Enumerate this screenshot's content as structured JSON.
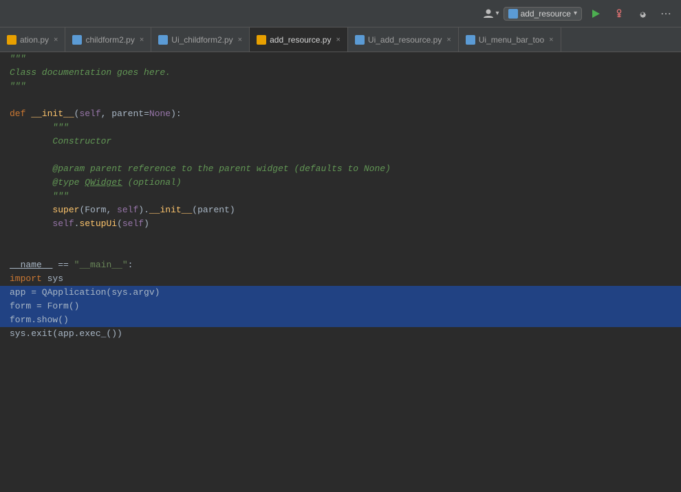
{
  "toolbar": {
    "run_config_label": "add_resource",
    "run_button_title": "Run",
    "debug_button_title": "Debug",
    "settings_title": "Settings"
  },
  "tabs": [
    {
      "id": "tab1",
      "label": "ation.py",
      "icon": "orange",
      "active": false,
      "closeable": true
    },
    {
      "id": "tab2",
      "label": "childform2.py",
      "icon": "blue",
      "active": false,
      "closeable": true
    },
    {
      "id": "tab3",
      "label": "Ui_childform2.py",
      "icon": "blue",
      "active": false,
      "closeable": true
    },
    {
      "id": "tab4",
      "label": "add_resource.py",
      "icon": "orange",
      "active": true,
      "closeable": true
    },
    {
      "id": "tab5",
      "label": "Ui_add_resource.py",
      "icon": "blue",
      "active": false,
      "closeable": true
    },
    {
      "id": "tab6",
      "label": "Ui_menu_bar_too",
      "icon": "blue",
      "active": false,
      "closeable": true
    }
  ],
  "code": {
    "lines": [
      {
        "num": "",
        "text": "\"\"\"",
        "type": "docstring",
        "highlighted": false
      },
      {
        "num": "",
        "text": "Class documentation goes here.",
        "type": "docstring",
        "highlighted": false
      },
      {
        "num": "",
        "text": "\"\"\"",
        "type": "docstring",
        "highlighted": false
      },
      {
        "num": "",
        "text": "",
        "type": "empty",
        "highlighted": false
      },
      {
        "num": "",
        "text": "def __init__(self, parent=None):",
        "type": "code",
        "highlighted": false
      },
      {
        "num": "",
        "text": "        \"\"\"",
        "type": "docstring",
        "highlighted": false
      },
      {
        "num": "",
        "text": "        Constructor",
        "type": "docstring",
        "highlighted": false
      },
      {
        "num": "",
        "text": "",
        "type": "empty",
        "highlighted": false
      },
      {
        "num": "",
        "text": "        @param parent reference to the parent widget (defaults to None)",
        "type": "docstring",
        "highlighted": false
      },
      {
        "num": "",
        "text": "        @type QWidget (optional)",
        "type": "docstring",
        "highlighted": false
      },
      {
        "num": "",
        "text": "        \"\"\"",
        "type": "docstring",
        "highlighted": false
      },
      {
        "num": "",
        "text": "        super(Form, self).__init__(parent)",
        "type": "code",
        "highlighted": false
      },
      {
        "num": "",
        "text": "        self.setupUi(self)",
        "type": "code",
        "highlighted": false
      },
      {
        "num": "",
        "text": "",
        "type": "empty",
        "highlighted": false
      },
      {
        "num": "",
        "text": "",
        "type": "empty",
        "highlighted": false
      },
      {
        "num": "",
        "text": "__name__ == \"__main__\":",
        "type": "code_if",
        "highlighted": false
      },
      {
        "num": "",
        "text": "import sys",
        "type": "code_import",
        "highlighted": false
      },
      {
        "num": "",
        "text": "app = QApplication(sys.argv)",
        "type": "code",
        "highlighted": true
      },
      {
        "num": "",
        "text": "form = Form()",
        "type": "code",
        "highlighted": true
      },
      {
        "num": "",
        "text": "form.show()",
        "type": "code",
        "highlighted": true
      },
      {
        "num": "",
        "text": "sys.exit(app.exec_())",
        "type": "code",
        "highlighted": false
      }
    ]
  }
}
